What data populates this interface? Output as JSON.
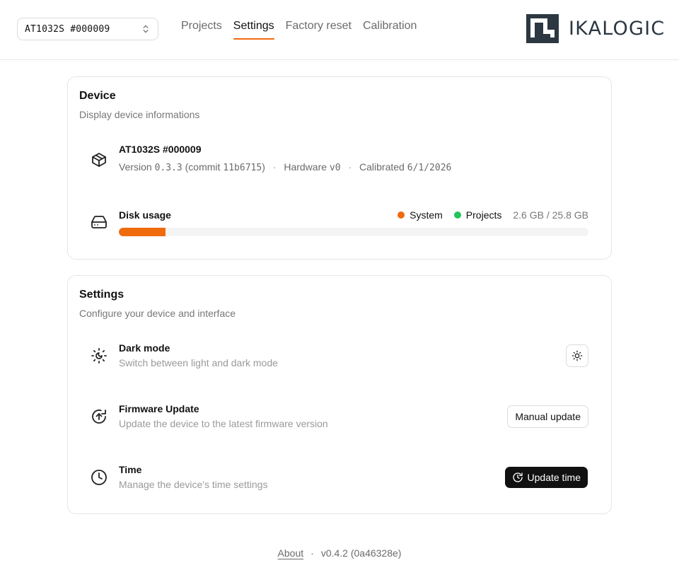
{
  "header": {
    "device_selector": {
      "value": "AT1032S #000009",
      "icon": "chevron-up-down-icon"
    },
    "tabs": [
      {
        "label": "Projects",
        "active": false
      },
      {
        "label": "Settings",
        "active": true
      },
      {
        "label": "Factory reset",
        "active": false
      },
      {
        "label": "Calibration",
        "active": false
      }
    ],
    "logo_text": "IKALOGIC",
    "accent_color": "#f06a0e"
  },
  "device_card": {
    "title": "Device",
    "subtitle": "Display device informations",
    "device": {
      "icon": "box-icon",
      "name": "AT1032S #000009",
      "version_label": "Version",
      "version": "0.3.3",
      "commit_prefix": "(commit",
      "commit": "11b6715",
      "commit_suffix": ")",
      "hardware_label": "Hardware",
      "hardware": "v0",
      "calibrated_label": "Calibrated",
      "calibrated": "6/1/2026"
    },
    "disk": {
      "icon": "hard-drive-icon",
      "label": "Disk usage",
      "legend": [
        {
          "name": "System",
          "color": "#f06a0e"
        },
        {
          "name": "Projects",
          "color": "#22c55e"
        }
      ],
      "usage_text": "2.6 GB / 25.8 GB",
      "used_fraction": 0.1
    }
  },
  "settings_card": {
    "title": "Settings",
    "subtitle": "Configure your device and interface",
    "rows": [
      {
        "icon": "sun-moon-icon",
        "title": "Dark mode",
        "subtitle": "Switch between light and dark mode",
        "action_icon": "sun-icon"
      },
      {
        "icon": "upload-circle-icon",
        "title": "Firmware Update",
        "subtitle": "Update the device to the latest firmware version",
        "action_label": "Manual update"
      },
      {
        "icon": "clock-icon",
        "title": "Time",
        "subtitle": "Manage the device's time settings",
        "action_label": "Update time",
        "action_icon": "clock-refresh-icon"
      }
    ]
  },
  "footer": {
    "about_label": "About",
    "separator": "·",
    "version": "v0.4.2 (0a46328e)"
  }
}
